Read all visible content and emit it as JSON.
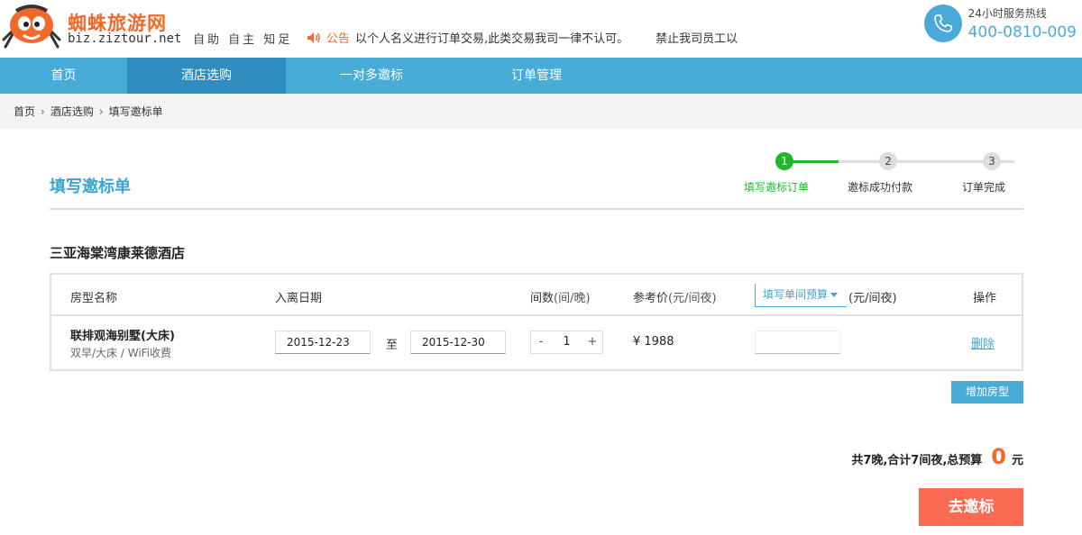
{
  "header": {
    "brand_name": "蜘蛛旅游网",
    "domain": "biz.ziztour.net",
    "slogan": "自助 自主 知足",
    "notice_label": "公告",
    "notice_text": "以个人名义进行订单交易,此类交易我司一律不认可。",
    "notice_text_2": "禁止我司员工以",
    "hotline_title": "24小时服务热线",
    "hotline_number": "400-0810-009"
  },
  "nav": {
    "items": [
      {
        "label": "首页"
      },
      {
        "label": "酒店选购"
      },
      {
        "label": "一对多邀标"
      },
      {
        "label": "订单管理"
      }
    ],
    "active_index": 1
  },
  "breadcrumb": [
    "首页",
    "酒店选购",
    "填写邀标单"
  ],
  "page_title": "填写邀标单",
  "steps": [
    {
      "number": "1",
      "label": "填写邀标订单",
      "state": "active"
    },
    {
      "number": "2",
      "label": "邀标成功付款",
      "state": "pending"
    },
    {
      "number": "3",
      "label": "订单完成",
      "state": "pending"
    }
  ],
  "hotel_name": "三亚海棠湾康莱德酒店",
  "table": {
    "headers": {
      "room_type": "房型名称",
      "dates": "入离日期",
      "rooms": "间数",
      "rooms_unit": "(间/晚)",
      "ref_price": "参考价",
      "ref_price_unit": "(元/间夜)",
      "budget_select": "填写单间预算",
      "budget_unit": "(元/间夜)",
      "action": "操作"
    },
    "rows": [
      {
        "room_name": "联排观海别墅(大床)",
        "room_desc": "双早/大床 / WiFi收费",
        "check_in": "2015-12-23",
        "to_label": "至",
        "check_out": "2015-12-30",
        "minus": "-",
        "count": "1",
        "plus": "+",
        "price": "¥ 1988",
        "budget": "",
        "delete_label": "删除"
      }
    ]
  },
  "add_room_label": "增加房型",
  "summary": {
    "text": "共7晚,合计7间夜,总预算",
    "amount": "0",
    "currency": "元"
  },
  "submit_label": "去邀标",
  "colors": {
    "brand_orange": "#f26a2b",
    "nav_blue": "#47acd8",
    "nav_active": "#2e8dbe",
    "step_active": "#1fb82b",
    "submit_red": "#fb6a52"
  }
}
